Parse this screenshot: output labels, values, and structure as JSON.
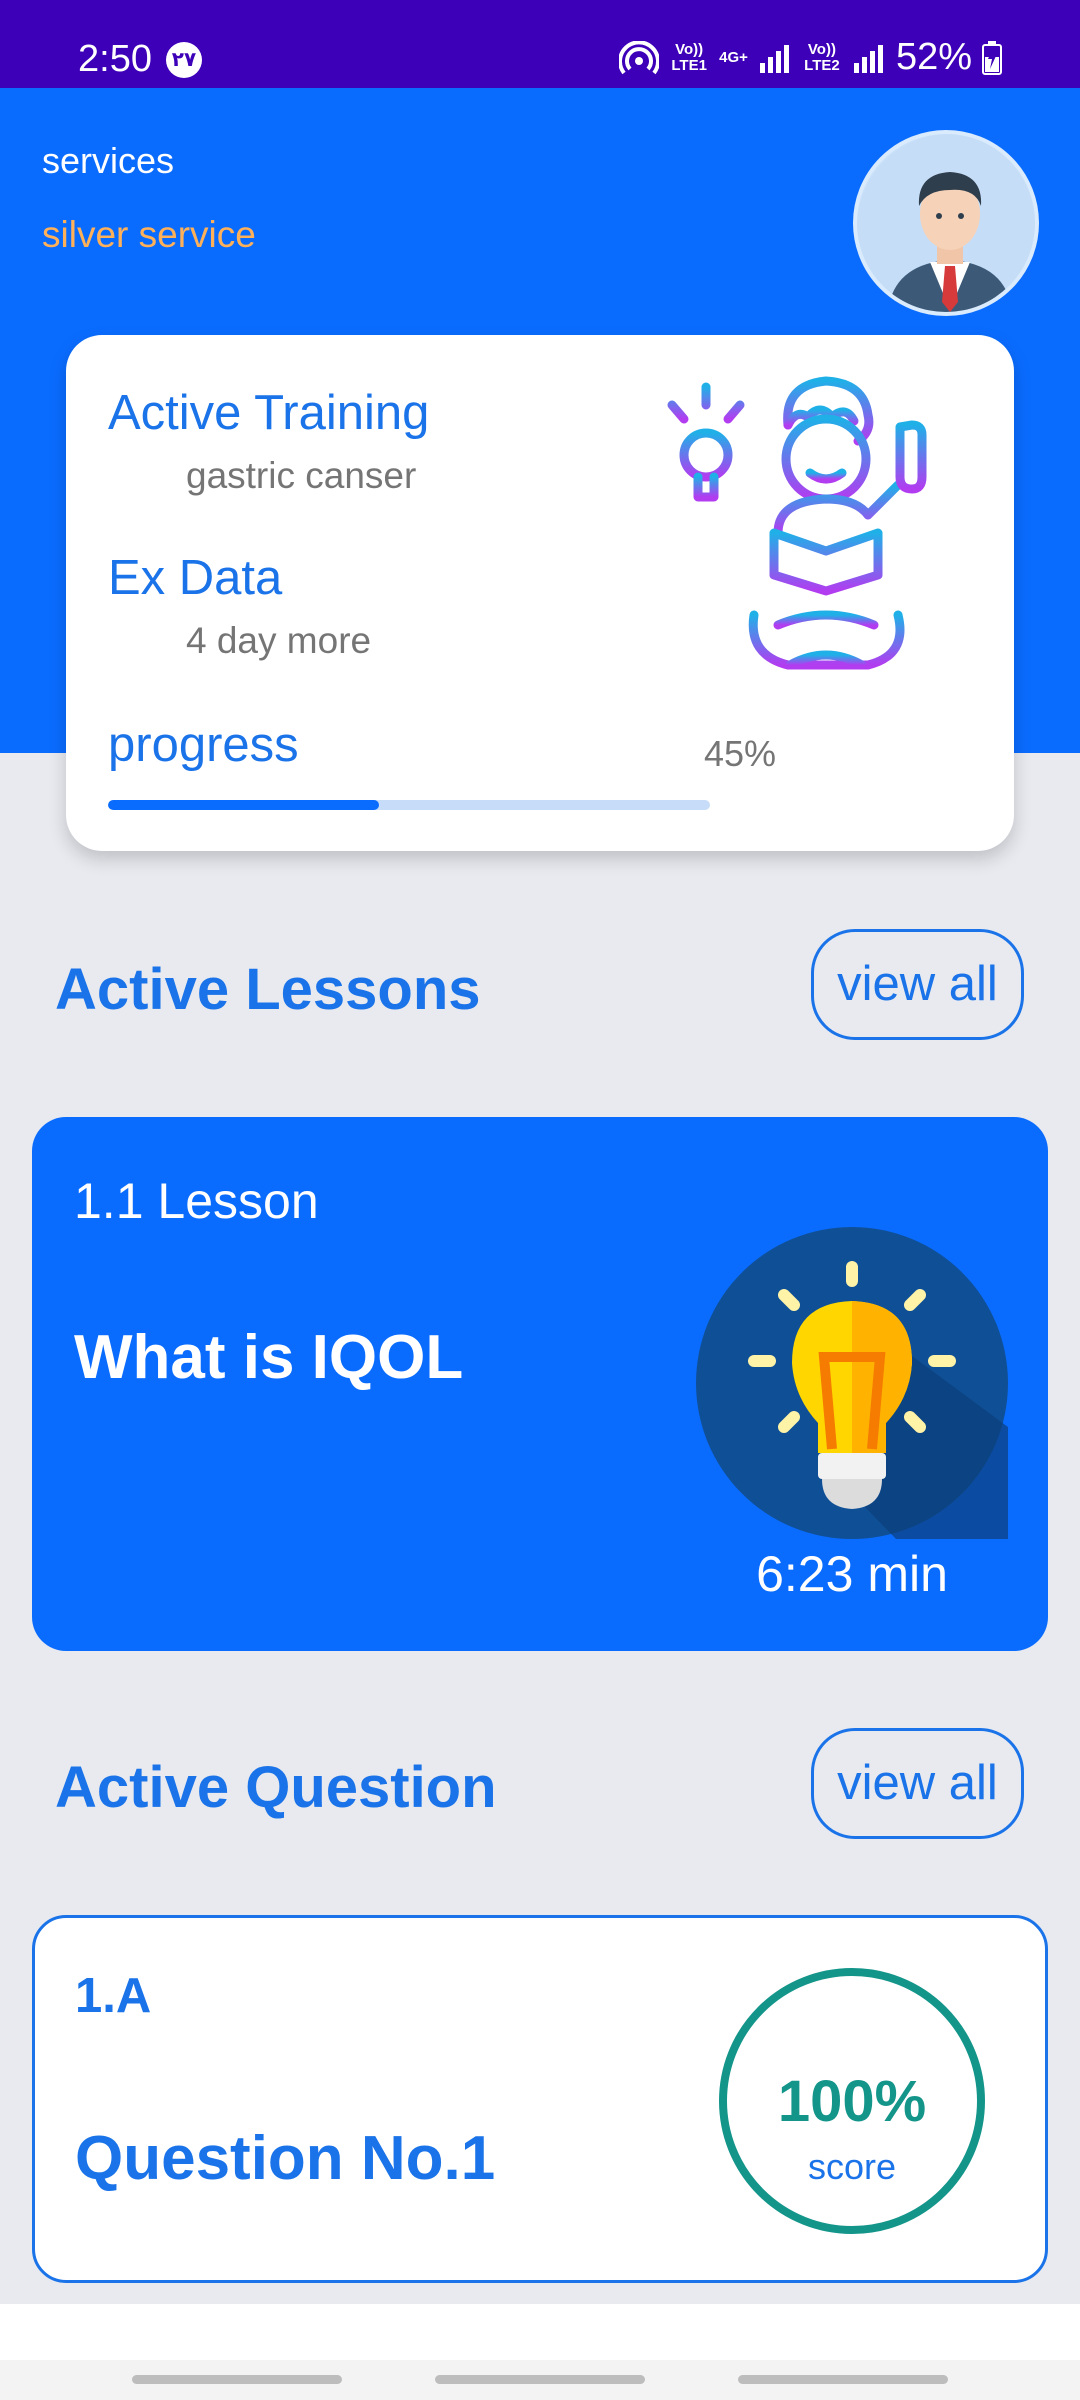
{
  "status_bar": {
    "time": "2:50",
    "notification_badge": "٢٧",
    "sim1_label": "Vo)) LTE1",
    "sim1_tech": "4G+",
    "sim2_label": "Vo)) LTE2",
    "battery": "52%",
    "icons": [
      "hotspot-icon",
      "signal-icon",
      "signal-icon",
      "battery-charging-icon"
    ]
  },
  "header": {
    "services_label": "services",
    "plan_label": "silver service",
    "avatar_icon": "businessman-avatar-icon"
  },
  "training_card": {
    "training_title": "Active Training",
    "training_value": "gastric canser",
    "ex_title": "Ex Data",
    "ex_value": "4 day more",
    "progress_label": "progress",
    "progress_text": "45%",
    "progress_value": 0.45,
    "illustration": "student-reading-idea-icon"
  },
  "lessons_section": {
    "title": "Active Lessons",
    "view_all": "view all"
  },
  "lesson_card": {
    "number": "1.1 Lesson",
    "title": "What is IQOL",
    "duration": "6:23 min",
    "icon": "light-bulb-icon"
  },
  "questions_section": {
    "title": "Active Question",
    "view_all": "view all"
  },
  "question_card": {
    "number": "1.A",
    "title": "Question No.1",
    "score_value": "100%",
    "score_label": "score"
  },
  "colors": {
    "primary": "#0a6cff",
    "status_bar": "#3d00b8",
    "accent_orange": "#ffb15a",
    "score_green": "#13958a",
    "background": "#e8eaf0"
  }
}
